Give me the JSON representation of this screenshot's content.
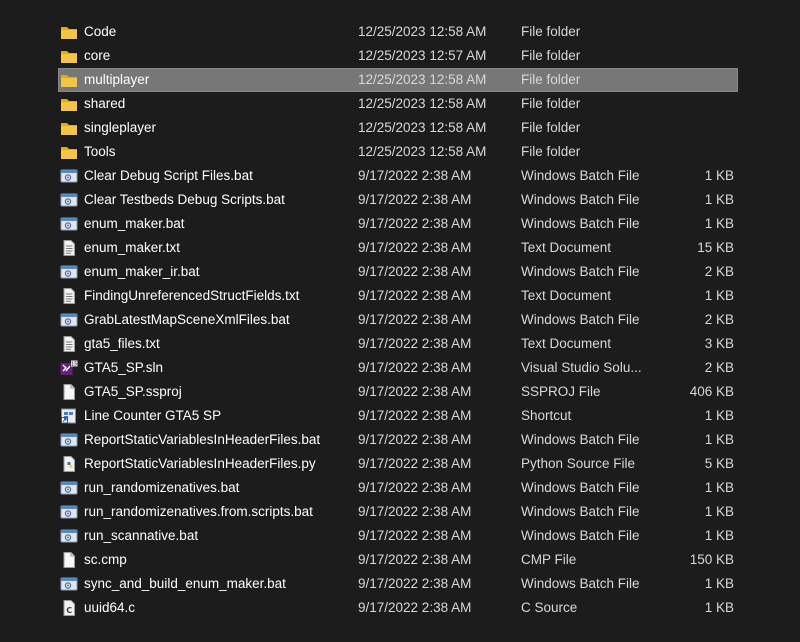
{
  "files": [
    {
      "name": "Code",
      "date": "12/25/2023 12:58 AM",
      "type": "File folder",
      "size": "",
      "icon": "folder-icon"
    },
    {
      "name": "core",
      "date": "12/25/2023 12:57 AM",
      "type": "File folder",
      "size": "",
      "icon": "folder-icon"
    },
    {
      "name": "multiplayer",
      "date": "12/25/2023 12:58 AM",
      "type": "File folder",
      "size": "",
      "icon": "folder-icon",
      "selected": true
    },
    {
      "name": "shared",
      "date": "12/25/2023 12:58 AM",
      "type": "File folder",
      "size": "",
      "icon": "folder-icon"
    },
    {
      "name": "singleplayer",
      "date": "12/25/2023 12:58 AM",
      "type": "File folder",
      "size": "",
      "icon": "folder-icon"
    },
    {
      "name": "Tools",
      "date": "12/25/2023 12:58 AM",
      "type": "File folder",
      "size": "",
      "icon": "folder-icon"
    },
    {
      "name": "Clear Debug Script Files.bat",
      "date": "9/17/2022 2:38 AM",
      "type": "Windows Batch File",
      "size": "1 KB",
      "icon": "batch-file-icon"
    },
    {
      "name": "Clear Testbeds Debug Scripts.bat",
      "date": "9/17/2022 2:38 AM",
      "type": "Windows Batch File",
      "size": "1 KB",
      "icon": "batch-file-icon"
    },
    {
      "name": "enum_maker.bat",
      "date": "9/17/2022 2:38 AM",
      "type": "Windows Batch File",
      "size": "1 KB",
      "icon": "batch-file-icon"
    },
    {
      "name": "enum_maker.txt",
      "date": "9/17/2022 2:38 AM",
      "type": "Text Document",
      "size": "15 KB",
      "icon": "text-document-icon"
    },
    {
      "name": "enum_maker_ir.bat",
      "date": "9/17/2022 2:38 AM",
      "type": "Windows Batch File",
      "size": "2 KB",
      "icon": "batch-file-icon"
    },
    {
      "name": "FindingUnreferencedStructFields.txt",
      "date": "9/17/2022 2:38 AM",
      "type": "Text Document",
      "size": "1 KB",
      "icon": "text-document-icon"
    },
    {
      "name": "GrabLatestMapSceneXmlFiles.bat",
      "date": "9/17/2022 2:38 AM",
      "type": "Windows Batch File",
      "size": "2 KB",
      "icon": "batch-file-icon"
    },
    {
      "name": "gta5_files.txt",
      "date": "9/17/2022 2:38 AM",
      "type": "Text Document",
      "size": "3 KB",
      "icon": "text-document-icon"
    },
    {
      "name": "GTA5_SP.sln",
      "date": "9/17/2022 2:38 AM",
      "type": "Visual Studio Solu...",
      "size": "2 KB",
      "icon": "visual-studio-solution-icon"
    },
    {
      "name": "GTA5_SP.ssproj",
      "date": "9/17/2022 2:38 AM",
      "type": "SSPROJ File",
      "size": "406 KB",
      "icon": "blank-file-icon"
    },
    {
      "name": "Line Counter GTA5 SP",
      "date": "9/17/2022 2:38 AM",
      "type": "Shortcut",
      "size": "1 KB",
      "icon": "shortcut-icon"
    },
    {
      "name": "ReportStaticVariablesInHeaderFiles.bat",
      "date": "9/17/2022 2:38 AM",
      "type": "Windows Batch File",
      "size": "1 KB",
      "icon": "batch-file-icon"
    },
    {
      "name": "ReportStaticVariablesInHeaderFiles.py",
      "date": "9/17/2022 2:38 AM",
      "type": "Python Source File",
      "size": "5 KB",
      "icon": "python-file-icon"
    },
    {
      "name": "run_randomizenatives.bat",
      "date": "9/17/2022 2:38 AM",
      "type": "Windows Batch File",
      "size": "1 KB",
      "icon": "batch-file-icon"
    },
    {
      "name": "run_randomizenatives.from.scripts.bat",
      "date": "9/17/2022 2:38 AM",
      "type": "Windows Batch File",
      "size": "1 KB",
      "icon": "batch-file-icon"
    },
    {
      "name": "run_scannative.bat",
      "date": "9/17/2022 2:38 AM",
      "type": "Windows Batch File",
      "size": "1 KB",
      "icon": "batch-file-icon"
    },
    {
      "name": "sc.cmp",
      "date": "9/17/2022 2:38 AM",
      "type": "CMP File",
      "size": "150 KB",
      "icon": "blank-file-icon"
    },
    {
      "name": "sync_and_build_enum_maker.bat",
      "date": "9/17/2022 2:38 AM",
      "type": "Windows Batch File",
      "size": "1 KB",
      "icon": "batch-file-icon"
    },
    {
      "name": "uuid64.c",
      "date": "9/17/2022 2:38 AM",
      "type": "C Source",
      "size": "1 KB",
      "icon": "c-source-file-icon"
    }
  ],
  "colors": {
    "background": "#1c1c1c",
    "selection": "#777777",
    "folder": "#f3c448",
    "secondary_text": "#d8d8d8"
  }
}
